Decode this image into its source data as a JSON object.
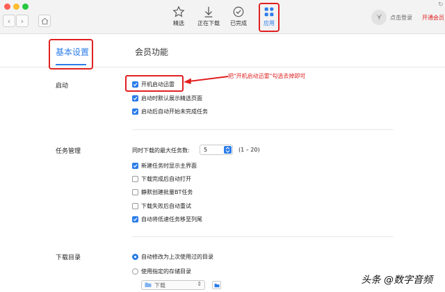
{
  "window": {
    "traffic_colors": [
      "#ff5f57",
      "#febc2e",
      "#28c840"
    ]
  },
  "toolbar": {
    "items": [
      {
        "label": "精选",
        "icon": "star-icon"
      },
      {
        "label": "正在下载",
        "icon": "download-arrow-icon"
      },
      {
        "label": "已完成",
        "icon": "check-circle-icon"
      },
      {
        "label": "应用",
        "icon": "apps-grid-icon",
        "active": true
      }
    ],
    "login_text": "点击登录",
    "member_text": "开通会员",
    "accent": "#2b7ce9",
    "highlight": "#e02020"
  },
  "tabs": [
    {
      "label": "基本设置",
      "active": true
    },
    {
      "label": "会员功能",
      "active": false
    }
  ],
  "annotation": "把\"开机启动迅雷\"勾选去掉即可",
  "startup": {
    "title": "启动",
    "options": [
      {
        "label": "开机启动迅雷",
        "checked": true
      },
      {
        "label": "启动时默认展示精选页面",
        "checked": true
      },
      {
        "label": "启动后自动开始未完成任务",
        "checked": true
      }
    ]
  },
  "tasks": {
    "title": "任务管理",
    "max_tasks_label": "同时下载的最大任务数:",
    "max_tasks_value": "5",
    "max_tasks_range": "(1 – 20)",
    "options": [
      {
        "label": "新建任务时显示主界面",
        "checked": true
      },
      {
        "label": "下载完成后自动打开",
        "checked": false
      },
      {
        "label": "静默创建批量BT任务",
        "checked": false
      },
      {
        "label": "下载失败后自动重试",
        "checked": false
      },
      {
        "label": "自动将低速任务移至列尾",
        "checked": true
      }
    ]
  },
  "download_dir": {
    "title": "下载目录",
    "options": [
      {
        "label": "自动修改为上次使用过的目录",
        "selected": true
      },
      {
        "label": "使用指定的存储目录",
        "selected": false
      }
    ],
    "folder_value": "下载"
  },
  "watermark": "头条 @数字音频"
}
